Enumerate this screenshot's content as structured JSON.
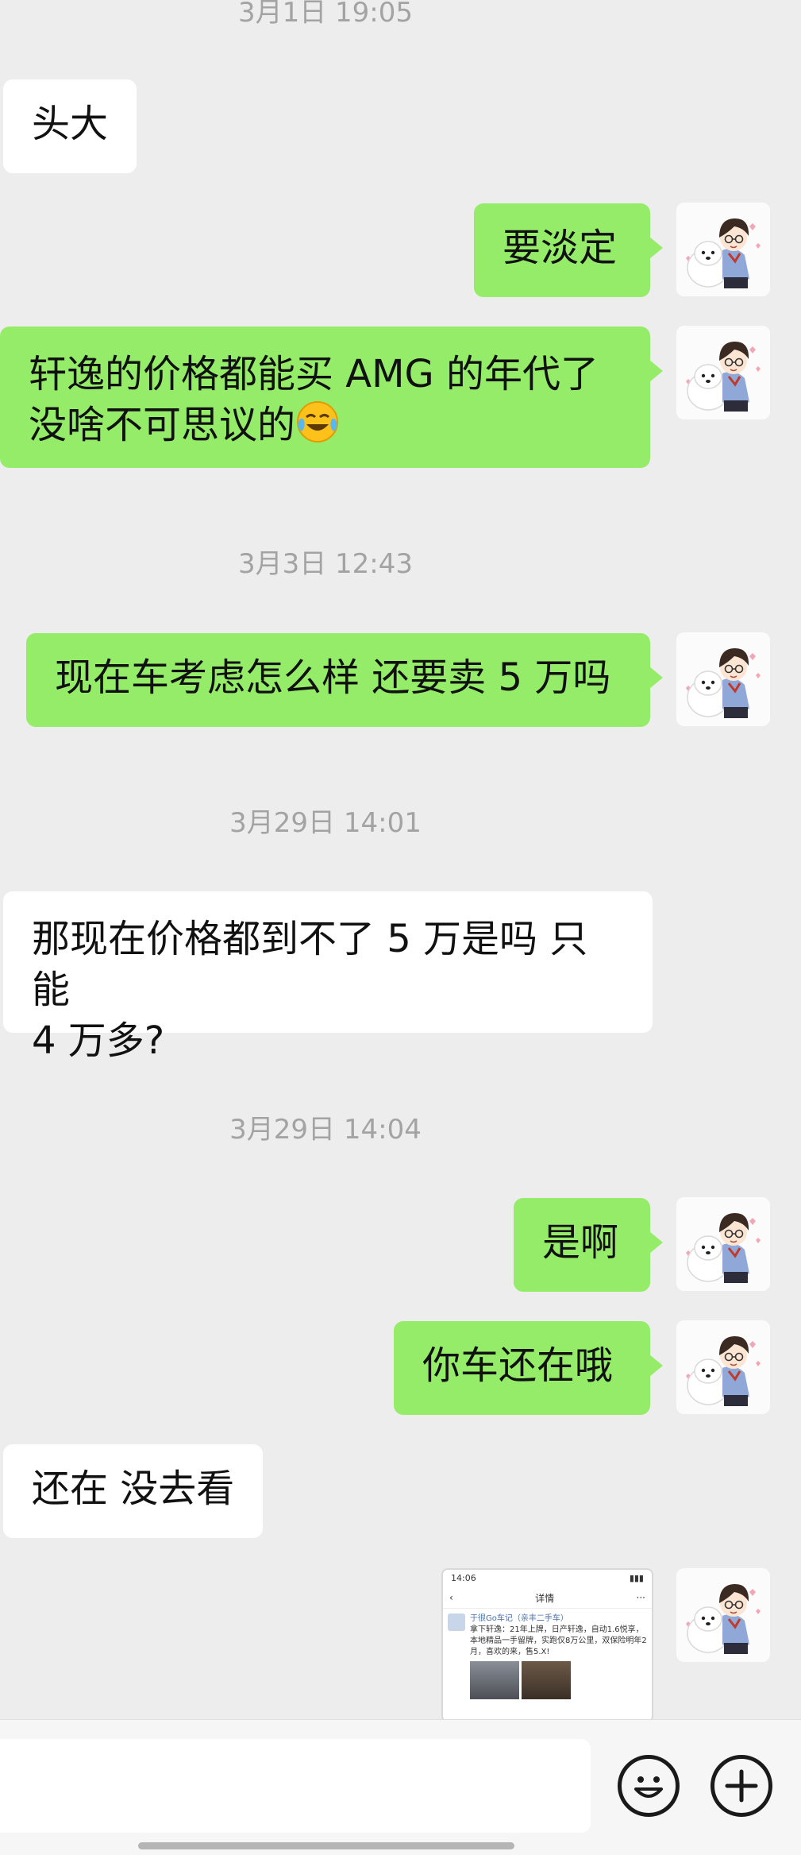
{
  "messages": {
    "ts1": "3月1日 19:05",
    "m1": "头大",
    "m2": "要淡定",
    "m3_line1": "轩逸的价格都能买 AMG 的年代了",
    "m3_line2": "没啥不可思议的",
    "ts2": "3月3日 12:43",
    "m4": "现在车考虑怎么样 还要卖 5 万吗",
    "ts3": "3月29日 14:01",
    "m5_line1": "那现在价格都到不了 5 万是吗 只能",
    "m5_line2": "4 万多?",
    "ts4": "3月29日 14:04",
    "m6": "是啊",
    "m7": "你车还在哦",
    "m8": "还在 没去看"
  },
  "shared_image": {
    "status_time": "14:06",
    "header": "详情",
    "author": "于很Go车记（亲丰二手车）",
    "text": "拿下轩逸：21年上牌，日产轩逸，自动1.6悦享，本地精品一手留牌，实跑仅8万公里，双保险明年2月，喜欢的来，售5.X!"
  },
  "icons": {
    "emoji": "face-with-tears-of-joy-icon",
    "emoji_button": "smiley-icon",
    "plus_button": "plus-icon"
  },
  "colors": {
    "sent_bubble": "#95ec69",
    "received_bubble": "#ffffff",
    "background": "#ededed"
  }
}
